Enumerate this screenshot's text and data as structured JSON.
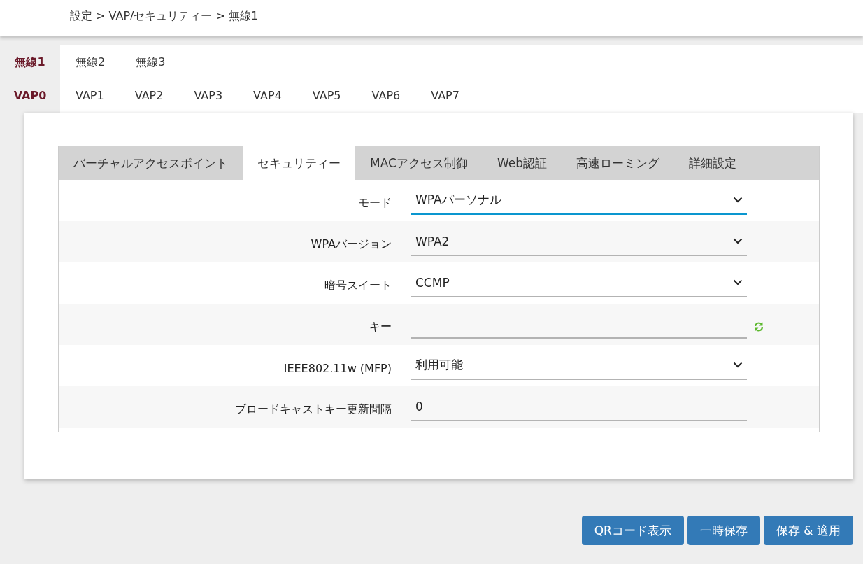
{
  "breadcrumb": "設定 > VAP/セキュリティー > 無線1",
  "radio_tabs": [
    {
      "label": "無線1",
      "selected": true
    },
    {
      "label": "無線2",
      "selected": false
    },
    {
      "label": "無線3",
      "selected": false
    }
  ],
  "vap_tabs": [
    {
      "label": "VAP0",
      "selected": true
    },
    {
      "label": "VAP1",
      "selected": false
    },
    {
      "label": "VAP2",
      "selected": false
    },
    {
      "label": "VAP3",
      "selected": false
    },
    {
      "label": "VAP4",
      "selected": false
    },
    {
      "label": "VAP5",
      "selected": false
    },
    {
      "label": "VAP6",
      "selected": false
    },
    {
      "label": "VAP7",
      "selected": false
    }
  ],
  "section_tabs": [
    {
      "label": "バーチャルアクセスポイント",
      "selected": false
    },
    {
      "label": "セキュリティー",
      "selected": true
    },
    {
      "label": "MACアクセス制御",
      "selected": false
    },
    {
      "label": "Web認証",
      "selected": false
    },
    {
      "label": "高速ローミング",
      "selected": false
    },
    {
      "label": "詳細設定",
      "selected": false
    }
  ],
  "fields": [
    {
      "label": "モード",
      "kind": "select",
      "value": "WPAパーソナル",
      "focused": true
    },
    {
      "label": "WPAバージョン",
      "kind": "select",
      "value": "WPA2",
      "focused": false
    },
    {
      "label": "暗号スイート",
      "kind": "select",
      "value": "CCMP",
      "focused": false
    },
    {
      "label": "キー",
      "kind": "key",
      "focused": false
    },
    {
      "label": "IEEE802.11w (MFP)",
      "kind": "select",
      "value": "利用可能",
      "focused": false
    },
    {
      "label": "ブロードキャストキー更新間隔",
      "kind": "text",
      "value": "0",
      "focused": false
    }
  ],
  "buttons": [
    "QRコード表示",
    "一時保存",
    "保存 & 適用"
  ]
}
